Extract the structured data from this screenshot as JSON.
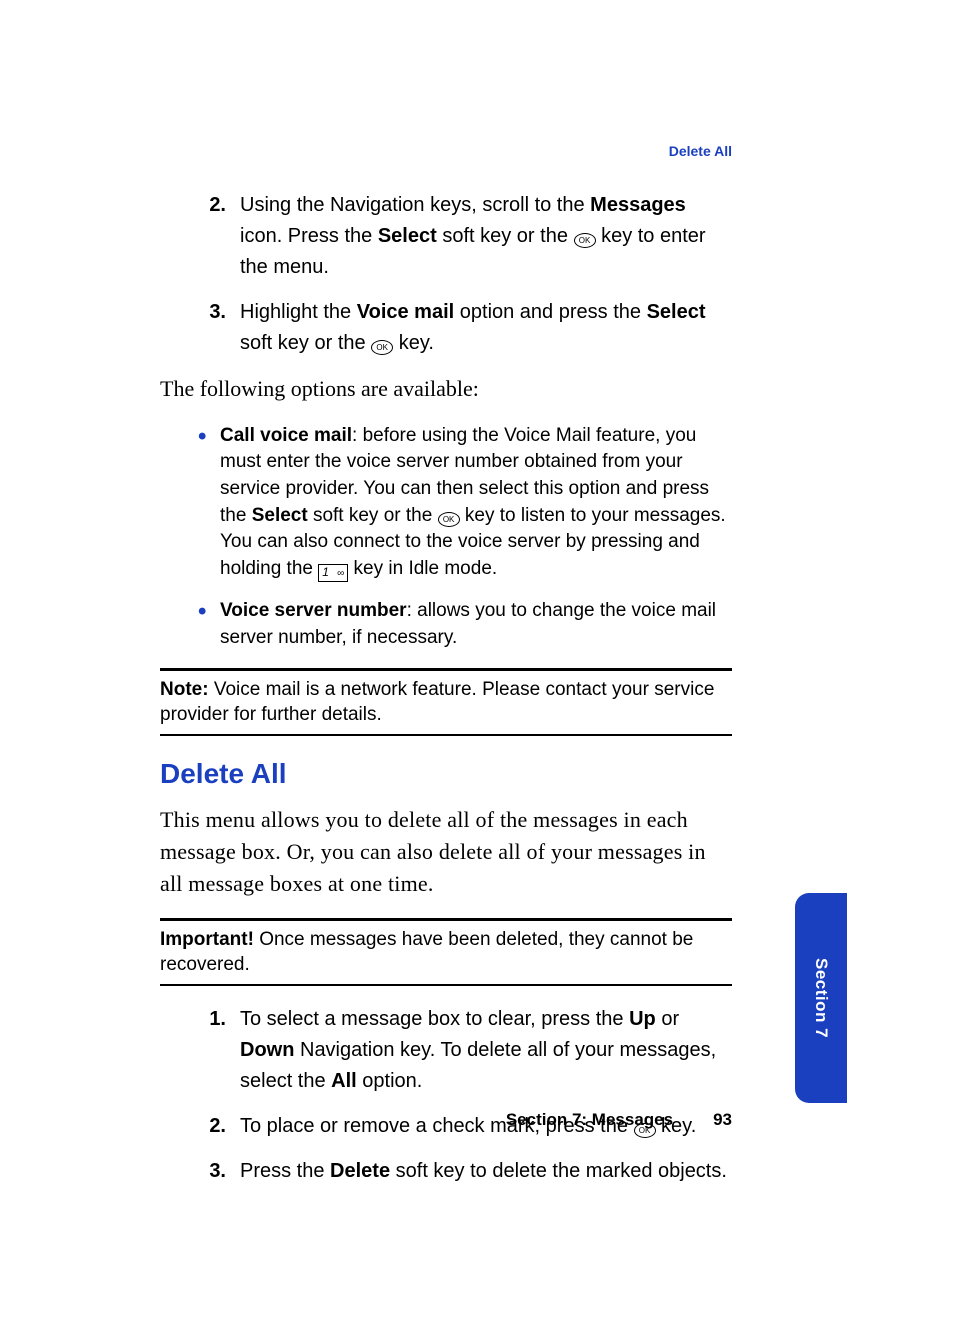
{
  "header": {
    "topic_link": "Delete All"
  },
  "steps_a": [
    {
      "num": "2.",
      "pre": "Using the Navigation keys, scroll to the ",
      "b1": "Messages",
      "mid1": " icon. Press the ",
      "b2": "Select",
      "mid2": " soft key or the ",
      "icon": "ok",
      "post": " key to enter the menu."
    },
    {
      "num": "3.",
      "pre": "Highlight the ",
      "b1": "Voice mail",
      "mid1": " option and press the ",
      "b2": "Select",
      "mid2": " soft key or the ",
      "icon": "ok",
      "post": " key."
    }
  ],
  "intro_a": "The following options are available:",
  "bullets": [
    {
      "lead": "Call voice mail",
      "mid1": ": before using the Voice Mail feature, you must enter the voice server number obtained from your service provider. You can then select this option and press the ",
      "b1": "Select",
      "mid2": " soft key or the ",
      "icon1": "ok",
      "mid3": " key to listen to your messages. You can also connect to the voice server by pressing and holding the ",
      "icon2": "key1",
      "post": " key in Idle mode."
    },
    {
      "lead": "Voice server number",
      "mid1": ": allows you to change the voice mail server number, if necessary."
    }
  ],
  "note": {
    "label": "Note:",
    "text": " Voice mail is a network feature. Please contact your service provider for further details."
  },
  "h2": "Delete All",
  "intro_b": "This menu allows you to delete all of the messages in each message box. Or, you can also delete all of your messages in all message boxes at one time.",
  "important": {
    "label": "Important!",
    "text": " Once messages have been deleted, they cannot be recovered."
  },
  "steps_b": [
    {
      "num": "1.",
      "pre": "To select a message box to clear, press the ",
      "b1": "Up",
      "mid1": " or ",
      "b2": "Down",
      "mid2": " Navigation key. To delete all of your messages, select the ",
      "b3": "All",
      "post": " option."
    },
    {
      "num": "2.",
      "pre": "To place or remove a check mark, press the ",
      "icon": "ok",
      "post": " key."
    },
    {
      "num": "3.",
      "pre": "Press the ",
      "b1": "Delete",
      "post": " soft key to delete the marked objects."
    }
  ],
  "footer": {
    "section": "Section 7: Messages",
    "page": "93"
  },
  "tab": "Section 7",
  "icons": {
    "ok": "OK",
    "key1": "1"
  }
}
